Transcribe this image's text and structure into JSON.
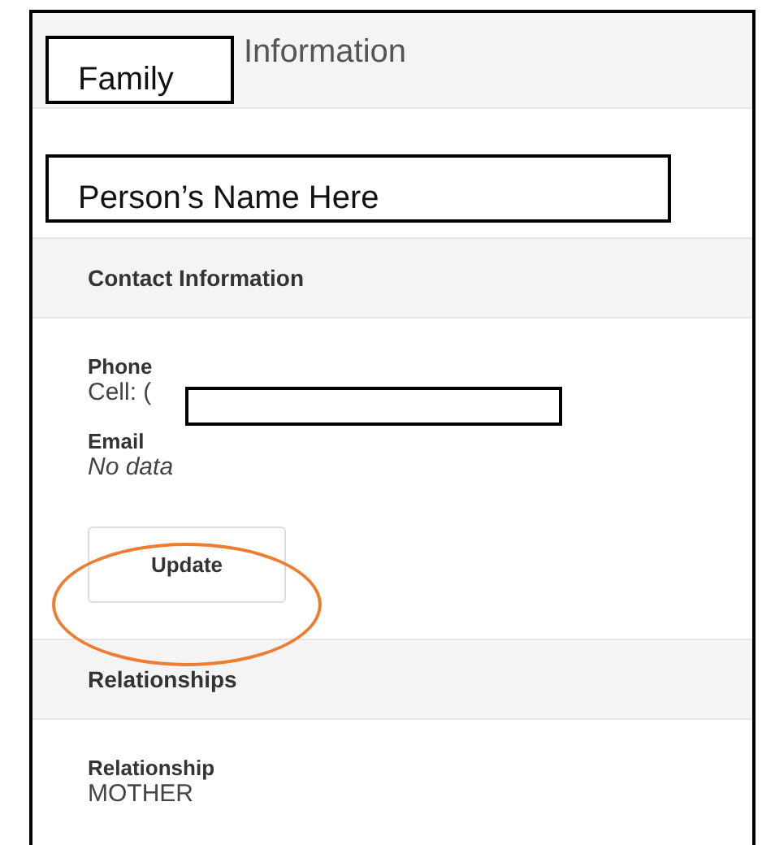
{
  "header": {
    "title": "Information"
  },
  "annotations": [
    {
      "kind": "label",
      "text": "Family"
    },
    {
      "kind": "label",
      "text": "Person’s Name Here"
    },
    {
      "kind": "redaction"
    },
    {
      "kind": "highlight"
    }
  ],
  "sections": [
    {
      "title": "Contact Information",
      "fields": [
        {
          "label": "Phone",
          "value": "Cell: (",
          "empty": false
        },
        {
          "label": "Email",
          "value": "No data",
          "empty": true
        }
      ],
      "button": "Update"
    },
    {
      "title": "Relationships",
      "fields": [
        {
          "label": "Relationship",
          "value": "MOTHER",
          "empty": false
        }
      ]
    }
  ]
}
